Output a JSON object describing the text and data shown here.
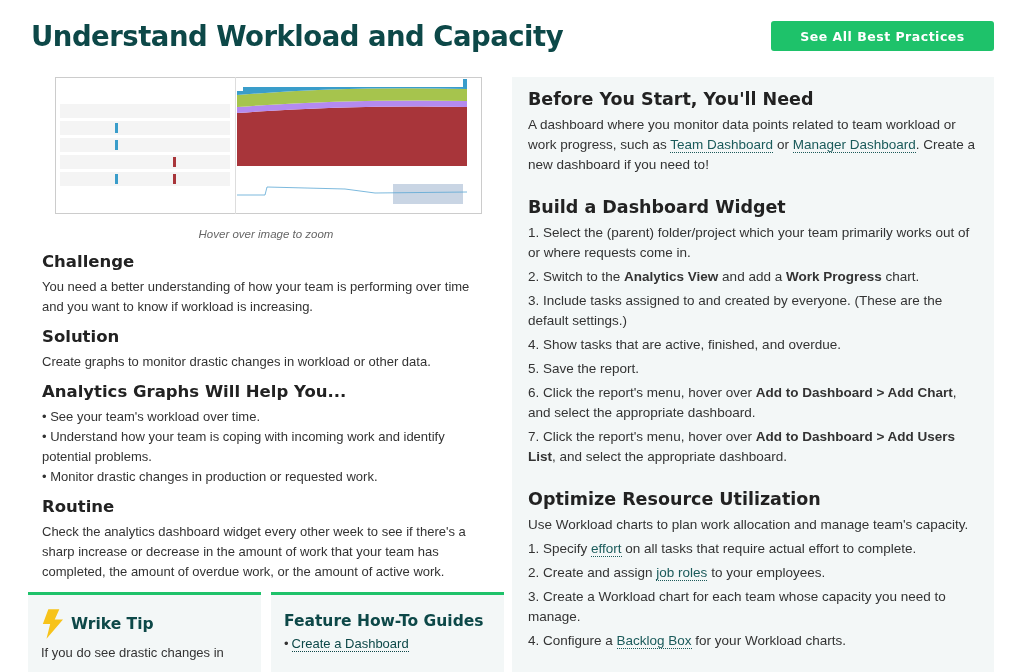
{
  "title": "Understand Workload and Capacity",
  "header_button": "See All Best Practices",
  "caption": "Hover over image to zoom",
  "left_sections": [
    {
      "heading": "Challenge",
      "lines": [
        "You need a better understanding of how your team is performing over time and you want to know if workload is increasing."
      ]
    },
    {
      "heading": "Solution",
      "lines": [
        "Create graphs to monitor drastic changes in workload or other data."
      ]
    },
    {
      "heading": "Analytics Graphs Will Help You...",
      "lines": [
        "• See your team's workload over time.",
        "• Understand how your team is coping with incoming work and identify potential problems.",
        "• Monitor drastic changes in production or requested work."
      ]
    },
    {
      "heading": "Routine",
      "lines": [
        "Check the analytics dashboard widget every other week to see if there's a sharp increase or decrease in the amount of work that your team has completed, the amount of overdue work, or the amount of active work."
      ]
    }
  ],
  "tip": {
    "heading": "Wrike Tip",
    "text": "If you do see drastic changes in"
  },
  "guides": {
    "heading": "Feature How-To Guides",
    "items": [
      {
        "bullet": "•",
        "link": "Create a Dashboard"
      }
    ]
  },
  "right_sections": [
    {
      "heading": "Before You Start, You'll Need",
      "items": [
        [
          {
            "kind": "text",
            "text": "A dashboard where you monitor data points related to team workload or work progress, such as "
          },
          {
            "kind": "link",
            "text": "Team Dashboard"
          },
          {
            "kind": "text",
            "text": " or "
          },
          {
            "kind": "link",
            "text": "Manager Dashboard"
          },
          {
            "kind": "text",
            "text": ". Create a new dashboard if you need to!"
          }
        ]
      ]
    },
    {
      "heading": "Build a Dashboard Widget",
      "items": [
        [
          {
            "kind": "text",
            "text": "1. Select the (parent) folder/project which your team primarily works out of or where requests come in."
          }
        ],
        [
          {
            "kind": "text",
            "text": "2. Switch to the **Analytics View** and add a **Work Progress** chart."
          }
        ],
        [
          {
            "kind": "text",
            "text": "3. Include tasks assigned to and created by everyone. (These are the default settings.)"
          }
        ],
        [
          {
            "kind": "text",
            "text": "4. Show tasks that are active, finished, and overdue."
          }
        ],
        [
          {
            "kind": "text",
            "text": "5. Save the report."
          }
        ],
        [
          {
            "kind": "text",
            "text": "6. Click the report's menu, hover over **Add to Dashboard > Add Chart**, and select the appropriate dashboard."
          }
        ],
        [
          {
            "kind": "text",
            "text": "7. Click the report's menu, hover over **Add to Dashboard > Add Users List**, and select the appropriate dashboard."
          }
        ]
      ]
    },
    {
      "heading": "Optimize Resource Utilization",
      "items": [
        [
          {
            "kind": "text",
            "text": "Use Workload charts to plan work allocation and manage team's capacity."
          }
        ],
        [
          {
            "kind": "text",
            "text": "1. Specify "
          },
          {
            "kind": "link",
            "text": "effort"
          },
          {
            "kind": "text",
            "text": " on all tasks that require actual effort to complete."
          }
        ],
        [
          {
            "kind": "text",
            "text": "2. Create and assign "
          },
          {
            "kind": "link",
            "text": "job roles"
          },
          {
            "kind": "text",
            "text": " to your employees."
          }
        ],
        [
          {
            "kind": "text",
            "text": "3. Create a Workload chart for each team whose capacity you need to manage."
          }
        ],
        [
          {
            "kind": "text",
            "text": "4. Configure a "
          },
          {
            "kind": "link",
            "text": "Backlog Box"
          },
          {
            "kind": "text",
            "text": " for your Workload charts."
          }
        ]
      ]
    }
  ]
}
